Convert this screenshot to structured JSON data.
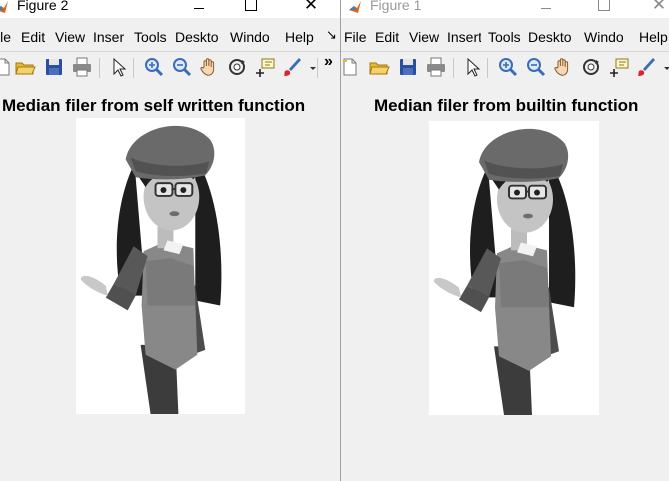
{
  "figure_left": {
    "title": "Figure 2",
    "menu": [
      "ile",
      "Edit",
      "View",
      "Inser",
      "Tools",
      "Deskto",
      "Windo",
      "Help"
    ],
    "overflow_glyph": "»",
    "dock_glyph": "↘",
    "axes_title": "Median filer from self written function"
  },
  "figure_right": {
    "title": "Figure 1",
    "menu": [
      "File",
      "Edit",
      "View",
      "Insert",
      "Tools",
      "Deskto",
      "Windo",
      "Help"
    ],
    "axes_title": "Median filer from builtin function"
  },
  "toolbar_icons": [
    "new-figure-icon",
    "open-folder-icon",
    "save-icon",
    "print-icon",
    "pointer-icon",
    "zoom-in-icon",
    "zoom-out-icon",
    "pan-hand-icon",
    "rotate-3d-icon",
    "data-cursor-icon",
    "brush-icon",
    "dropdown-arrow-icon"
  ],
  "window_controls": {
    "minimize": "–",
    "close": "✕"
  },
  "colors": {
    "background": "#f0f0f0",
    "title_active": "#000000",
    "title_inactive": "#9a9a9a",
    "save_icon": "#2b4fa0",
    "folder_icon": "#e8b830"
  }
}
